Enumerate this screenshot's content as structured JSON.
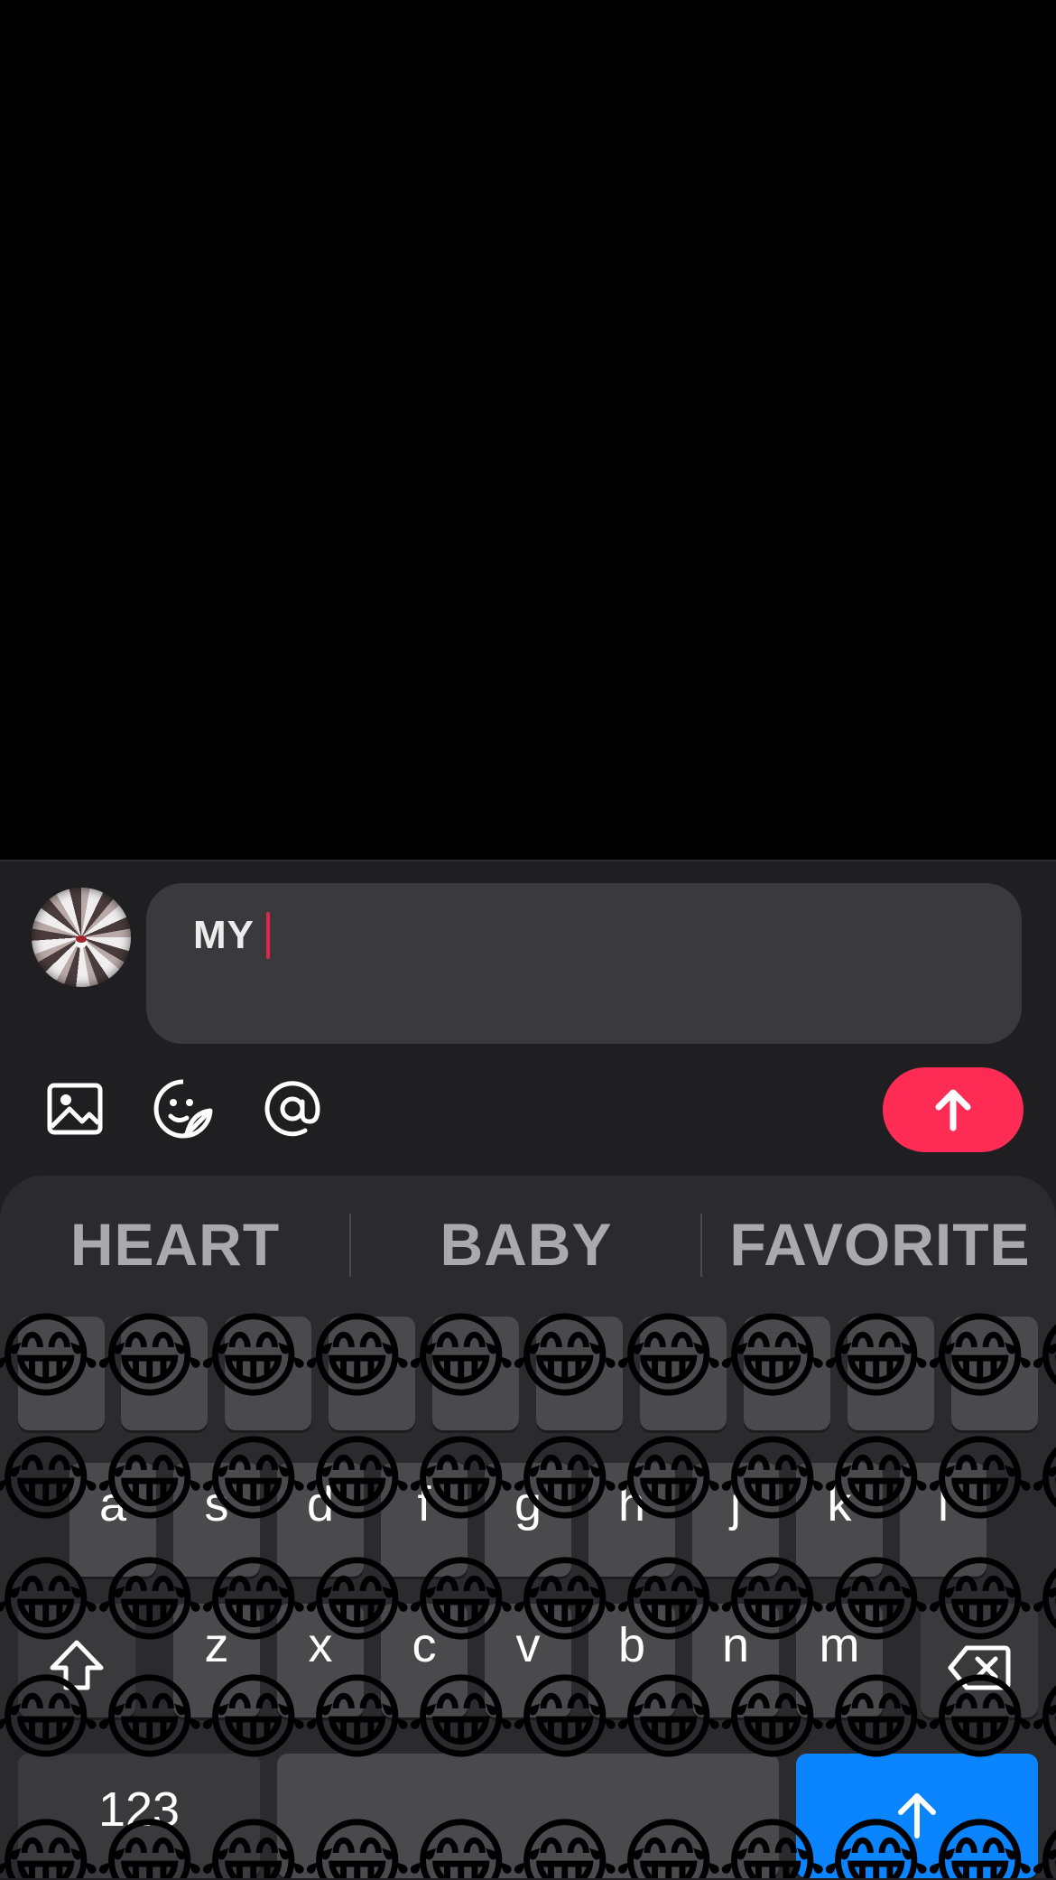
{
  "composer": {
    "text": "MY"
  },
  "toolbar": {
    "icons": [
      "image-icon",
      "sticker-icon",
      "mention-icon"
    ],
    "send_icon": "arrow-up-icon",
    "send_color": "#fe2c55"
  },
  "keyboard": {
    "suggestions": [
      "HEART",
      "BABY",
      "FAVORITE"
    ],
    "row2": [
      "a",
      "s",
      "d",
      "f",
      "g",
      "h",
      "j",
      "k",
      "l"
    ],
    "row3": [
      "z",
      "x",
      "c",
      "v",
      "b",
      "n",
      "m"
    ],
    "numbers_label": "123",
    "emoji": "😂",
    "send_key_color": "#0a84ff"
  }
}
